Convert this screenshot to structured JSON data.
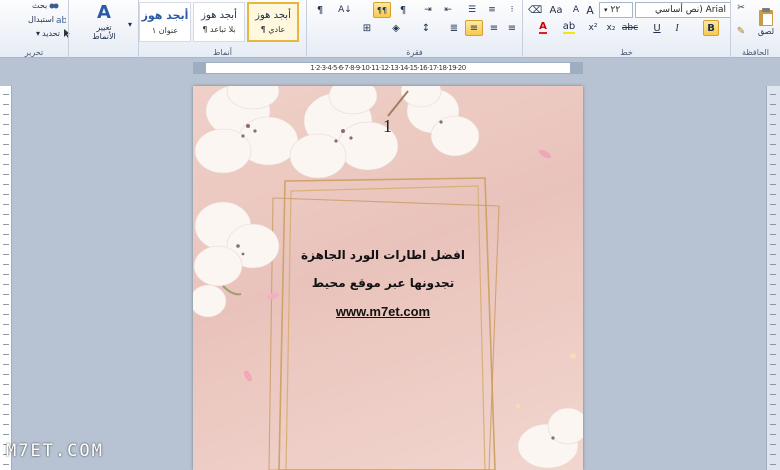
{
  "ribbon": {
    "groups": {
      "clipboard": {
        "caption": "الحافظة",
        "paste_label": "لصق"
      },
      "font": {
        "caption": "خط",
        "font_name": "Arial (نص أساسي",
        "font_size": "٢٢",
        "bold": "B",
        "italic": "I",
        "underline": "U",
        "grow": "A",
        "shrink": "A",
        "change_case": "Aa"
      },
      "paragraph": {
        "caption": "فقرة",
        "show_marks": "¶",
        "rtl_marks": "¶¶",
        "ltr": "¶"
      },
      "styles": {
        "caption": "أنماط",
        "tiles": [
          {
            "sample": "أبجد هوز",
            "name": "¶ عادي",
            "selected": true
          },
          {
            "sample": "أبجد هوز",
            "name": "¶ بلا تباعد",
            "selected": false
          },
          {
            "sample": "أبجد هوز",
            "name": "عنوان ١",
            "selected": false
          }
        ],
        "change_styles": "تغيير الأنماط"
      },
      "editing": {
        "caption": "تحرير",
        "find": "بحث",
        "replace": "استبدال",
        "select": "تحديد"
      }
    }
  },
  "document": {
    "page_number": "1",
    "line1": "افضل اطارات الورد الجاهزة",
    "line2": "تجدونها عبر موقع محيط",
    "link": "www.m7et.com"
  },
  "ruler": {
    "labels": "1·2·3·4·5·6·7·8·9·10·11·12·13·14·15·16·17·18·19·20"
  },
  "watermark": "M7ET.COM",
  "colors": {
    "accent": "#e8b541",
    "page_bg": "#ecc9c1",
    "frame": "#cfa36a"
  }
}
